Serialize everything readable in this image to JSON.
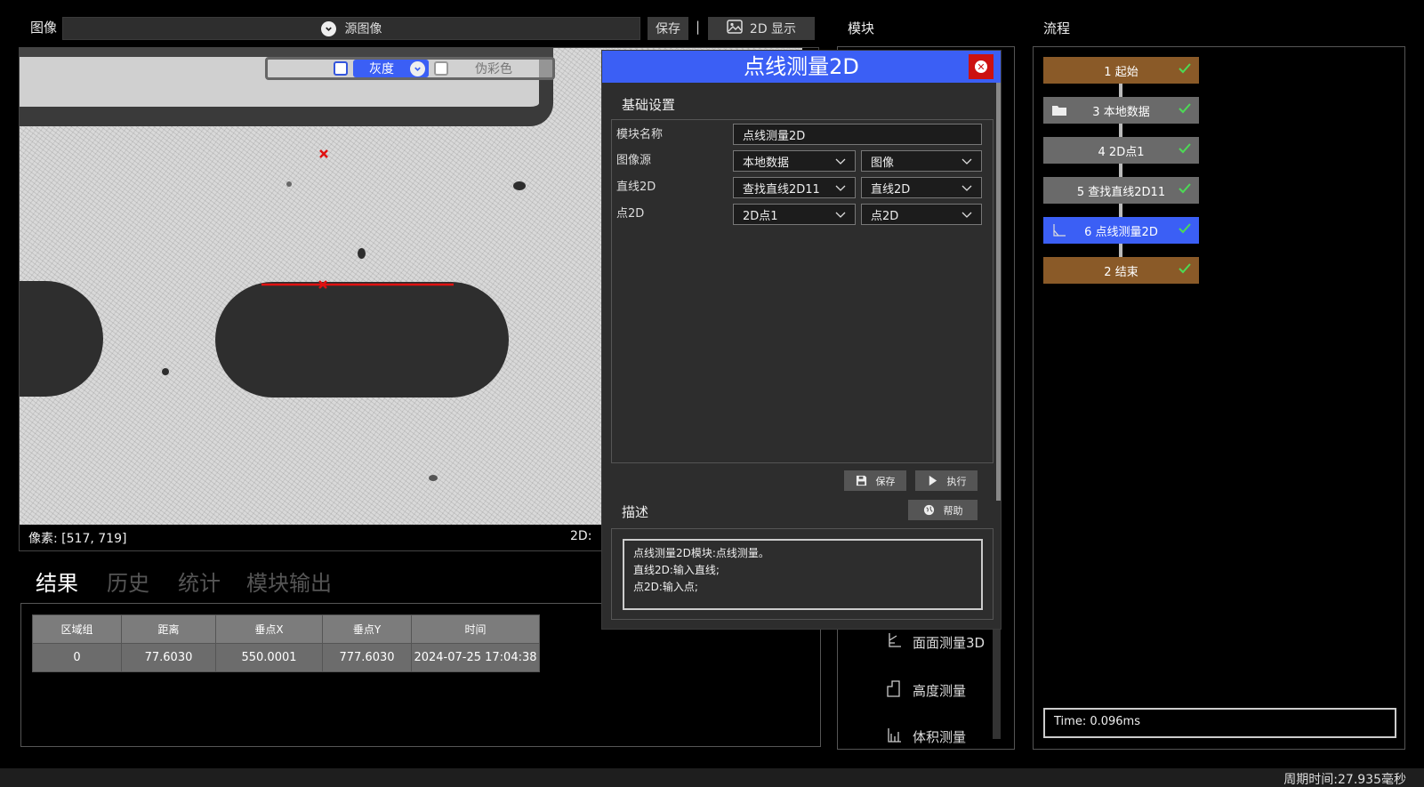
{
  "image_bar": {
    "label": "图像",
    "source": "源图像",
    "save": "保存",
    "separator": "|",
    "display": "2D 显示"
  },
  "viewer": {
    "gray_label": "灰度",
    "pseudo_color_label": "伪彩色",
    "pixel_readout": "像素: [517, 719]",
    "cs_readout": "2D:"
  },
  "results": {
    "tabs": [
      "结果",
      "历史",
      "统计",
      "模块输出"
    ],
    "active_tab": 0,
    "columns": [
      "区域组",
      "距离",
      "垂点X",
      "垂点Y",
      "时间"
    ],
    "rows": [
      [
        "0",
        "77.6030",
        "550.0001",
        "777.6030",
        "2024-07-25 17:04:38"
      ]
    ]
  },
  "modules": {
    "title": "模块",
    "items": [
      {
        "label": "面面测量3D",
        "icon": "plane-measure-icon"
      },
      {
        "label": "高度测量",
        "icon": "height-measure-icon"
      },
      {
        "label": "体积测量",
        "icon": "volume-measure-icon"
      }
    ]
  },
  "flow": {
    "title": "流程",
    "nodes": [
      {
        "label": "1 起始",
        "color": "#8a5a28",
        "icon": ""
      },
      {
        "label": "3 本地数据",
        "color": "#6a6a6a",
        "icon": "folder-icon"
      },
      {
        "label": "4 2D点1",
        "color": "#6a6a6a",
        "icon": ""
      },
      {
        "label": "5 查找直线2D11",
        "color": "#6a6a6a",
        "icon": ""
      },
      {
        "label": "6 点线测量2D",
        "color": "#3b5ff5",
        "icon": "angle-icon"
      },
      {
        "label": "2 结束",
        "color": "#8a5a28",
        "icon": ""
      }
    ],
    "time": "Time: 0.096ms"
  },
  "dialog": {
    "title": "点线测量2D",
    "basic_section": "基础设置",
    "fields": {
      "name_label": "模块名称",
      "name_value": "点线测量2D",
      "image_source_label": "图像源",
      "image_source_a": "本地数据",
      "image_source_b": "图像",
      "line_label": "直线2D",
      "line_a": "查找直线2D11",
      "line_b": "直线2D",
      "point_label": "点2D",
      "point_a": "2D点1",
      "point_b": "点2D"
    },
    "save": "保存",
    "execute": "执行",
    "desc_section": "描述",
    "help": "帮助",
    "description_lines": [
      "点线测量2D模块:点线测量。",
      "直线2D:输入直线;",
      "点2D:输入点;"
    ]
  },
  "status": {
    "cycle_time": "周期时间:27.935毫秒"
  },
  "colors": {
    "accent": "#3b5ff5",
    "flow_terminal": "#8a5a28",
    "check": "#4cdb55",
    "marker": "#e01010",
    "close": "#cc1111"
  }
}
